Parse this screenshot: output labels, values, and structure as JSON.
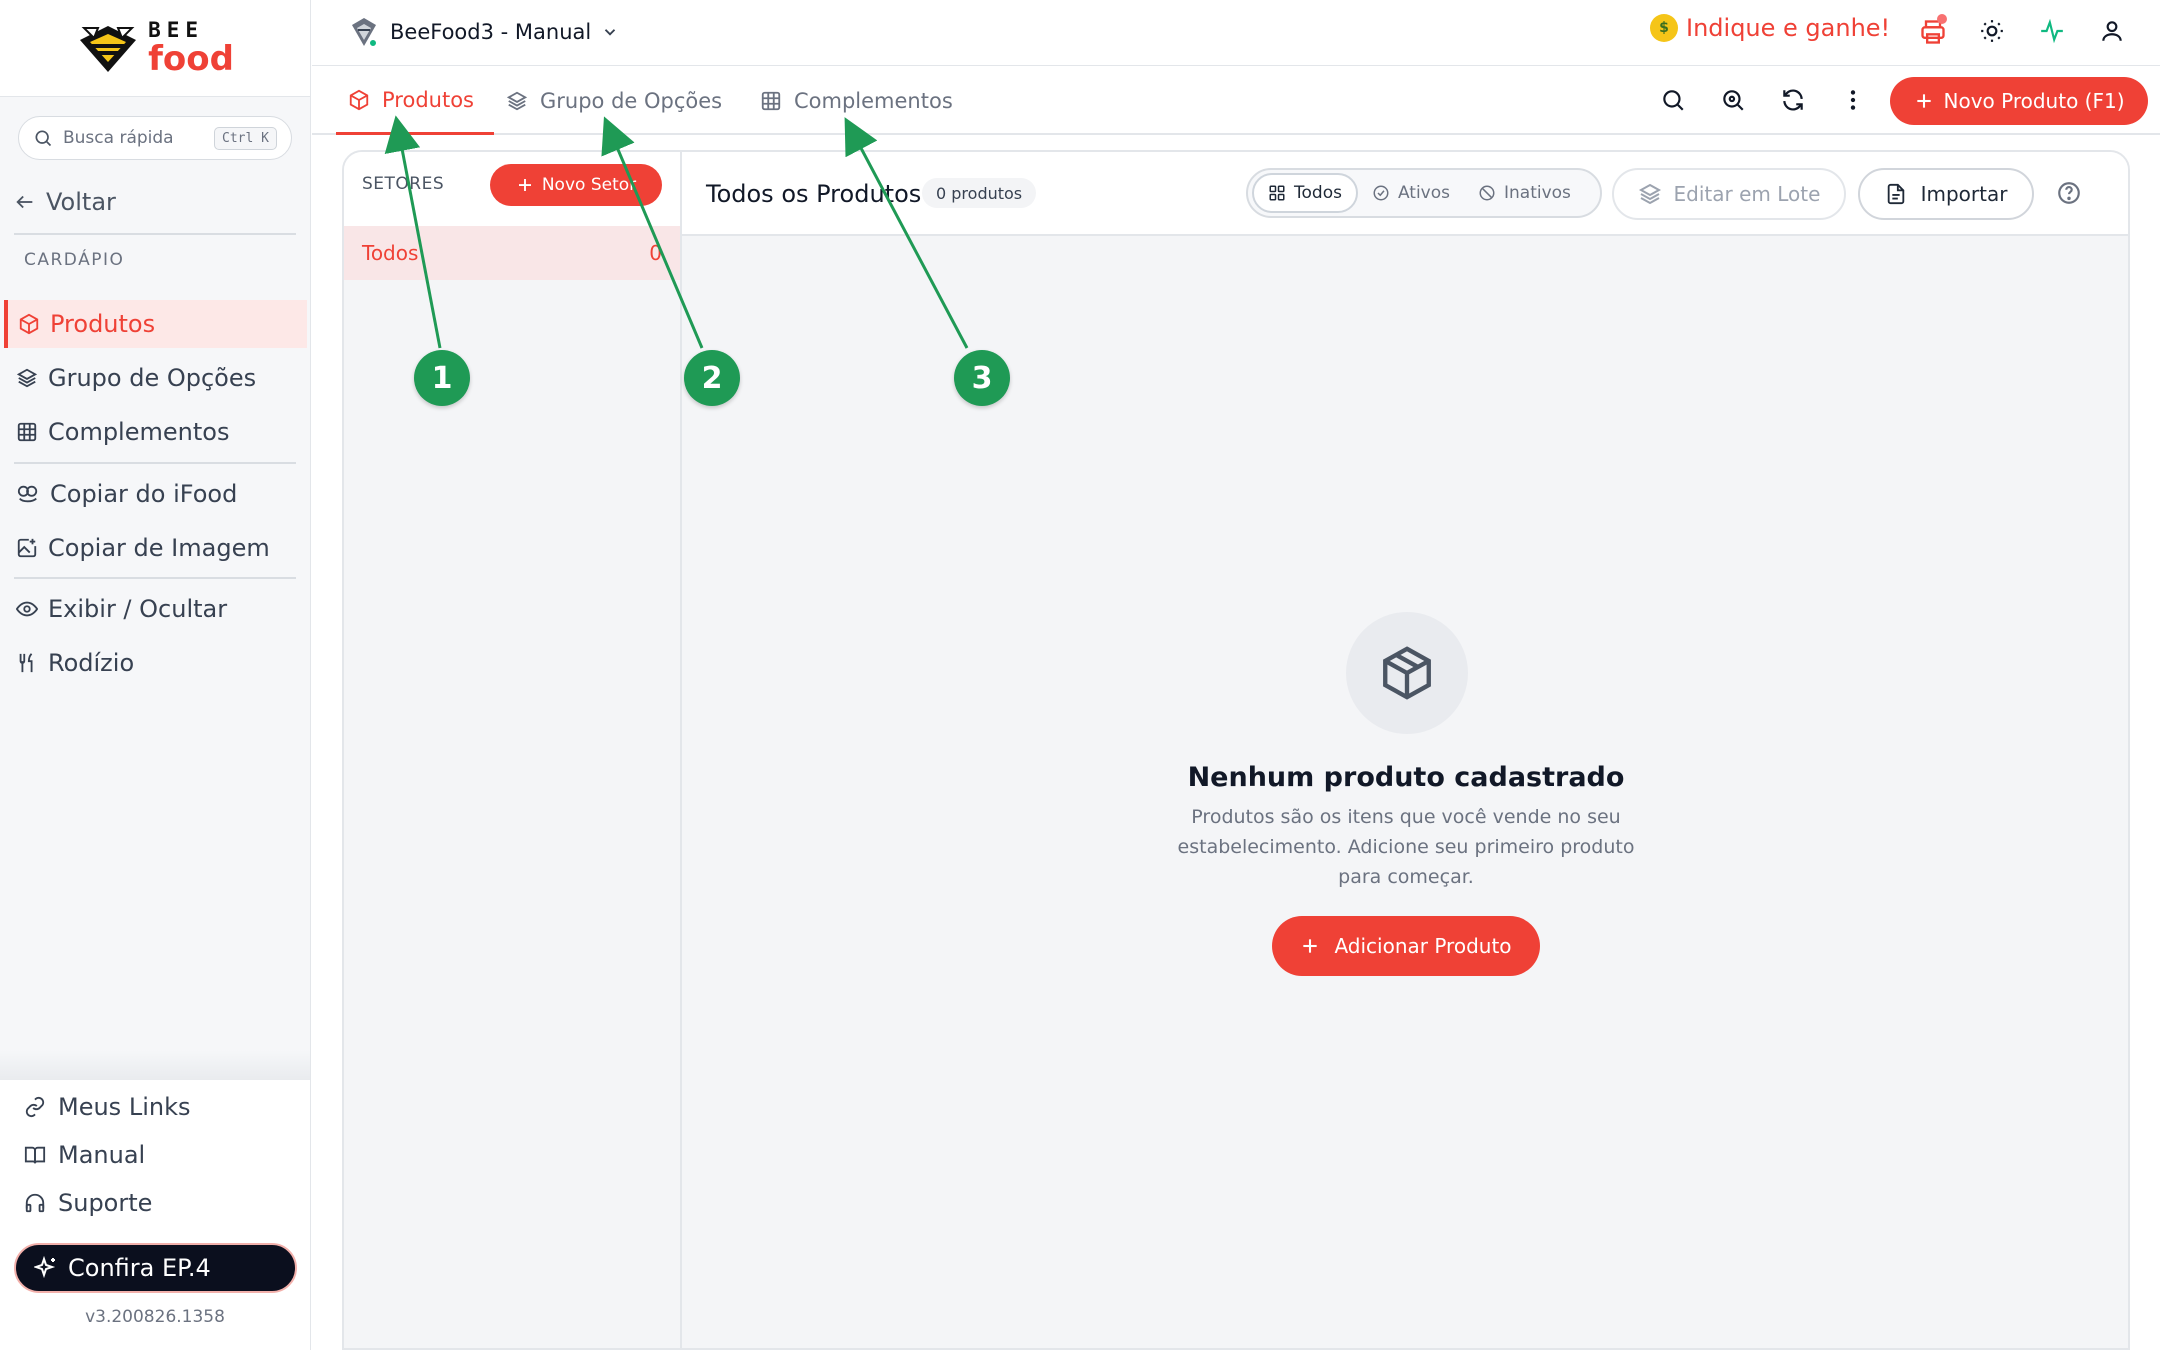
{
  "brand": {
    "top": "BEE",
    "bottom": "food"
  },
  "search": {
    "placeholder": "Busca rápida",
    "shortcut": "Ctrl K"
  },
  "sidebar": {
    "back_label": "Voltar",
    "section_label": "CARDÁPIO",
    "items": [
      {
        "label": "Produtos",
        "icon": "box-icon",
        "active": true
      },
      {
        "label": "Grupo de Opções",
        "icon": "layers-icon"
      },
      {
        "label": "Complementos",
        "icon": "grid-icon"
      },
      {
        "label": "Copiar do iFood",
        "icon": "ifood-icon"
      },
      {
        "label": "Copiar de Imagem",
        "icon": "image-plus-icon"
      },
      {
        "label": "Exibir / Ocultar",
        "icon": "eye-icon"
      },
      {
        "label": "Rodízio",
        "icon": "utensils-icon"
      }
    ],
    "bottom_items": [
      {
        "label": "Meus Links",
        "icon": "link-icon"
      },
      {
        "label": "Manual",
        "icon": "book-icon"
      },
      {
        "label": "Suporte",
        "icon": "headset-icon"
      }
    ],
    "promo_label": "Confira EP.4",
    "version": "v3.200826.1358"
  },
  "header": {
    "store_name": "BeeFood3 - Manual",
    "referral_label": "Indique e ganhe!"
  },
  "tabs": [
    {
      "label": "Produtos",
      "active": true
    },
    {
      "label": "Grupo de Opções"
    },
    {
      "label": "Complementos"
    }
  ],
  "toolbar": {
    "new_product_label": "Novo Produto (F1)"
  },
  "setores": {
    "label": "SETORES",
    "new_label": "Novo Setor",
    "rows": [
      {
        "name": "Todos",
        "count": "0"
      }
    ]
  },
  "content": {
    "title": "Todos os Produtos",
    "count": "0 produtos",
    "filters": [
      {
        "label": "Todos",
        "active": true
      },
      {
        "label": "Ativos"
      },
      {
        "label": "Inativos"
      }
    ],
    "batch_edit_label": "Editar em Lote",
    "import_label": "Importar"
  },
  "empty": {
    "title": "Nenhum produto cadastrado",
    "description": "Produtos são os itens que você vende no seu estabelecimento. Adicione seu primeiro produto para começar.",
    "button_label": "Adicionar Produto"
  },
  "annotations": [
    "1",
    "2",
    "3"
  ],
  "colors": {
    "accent": "#ef4136",
    "annotation": "#1f9a55",
    "online": "#10b981"
  }
}
